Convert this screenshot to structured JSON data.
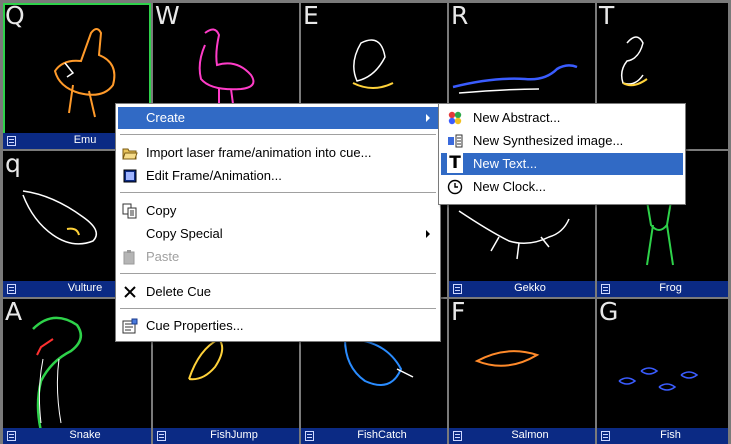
{
  "cues": [
    {
      "key": "Q",
      "name": "Emu"
    },
    {
      "key": "W",
      "name": ""
    },
    {
      "key": "E",
      "name": ""
    },
    {
      "key": "R",
      "name": ""
    },
    {
      "key": "T",
      "name": ""
    },
    {
      "key": "q",
      "name": "Vulture"
    },
    {
      "key": "",
      "name": ""
    },
    {
      "key": "",
      "name": ""
    },
    {
      "key": "",
      "name": "Gekko"
    },
    {
      "key": "",
      "name": "Frog"
    },
    {
      "key": "A",
      "name": "Snake"
    },
    {
      "key": "",
      "name": "FishJump"
    },
    {
      "key": "",
      "name": "FishCatch"
    },
    {
      "key": "F",
      "name": "Salmon"
    },
    {
      "key": "G",
      "name": "Fish"
    }
  ],
  "context_menu": {
    "create": "Create",
    "import": "Import laser frame/animation into cue...",
    "edit": "Edit Frame/Animation...",
    "copy": "Copy",
    "copy_special": "Copy Special",
    "paste": "Paste",
    "delete": "Delete Cue",
    "properties": "Cue Properties..."
  },
  "create_submenu": {
    "new_abstract": "New Abstract...",
    "new_synth": "New Synthesized image...",
    "new_text": "New Text...",
    "new_clock": "New Clock..."
  },
  "colors": {
    "selection": "#316ac5",
    "cue_bar": "#0b2a84",
    "selected_cue_border": "#2ed24a"
  }
}
